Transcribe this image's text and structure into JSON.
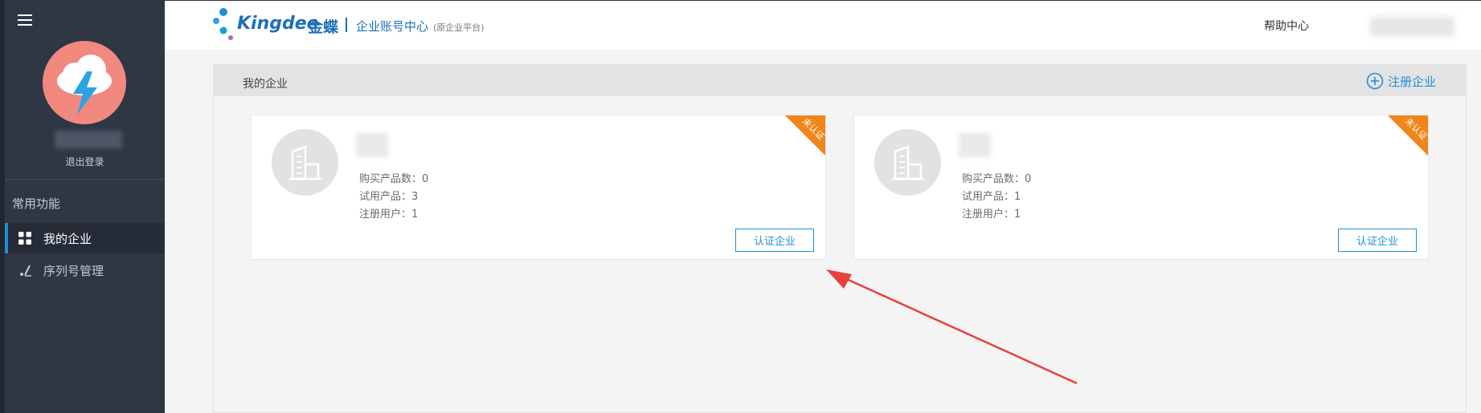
{
  "sidebar": {
    "logout_label": "退出登录",
    "section_title": "常用功能",
    "items": [
      {
        "label": "我的企业",
        "icon": "grid-icon",
        "active": true
      },
      {
        "label": "序列号管理",
        "icon": "brush-icon",
        "active": false
      }
    ]
  },
  "header": {
    "brand": "Kingdee",
    "brand_cn": "金蝶",
    "title": "企业账号中心",
    "subtitle": "(原企业平台)",
    "help_label": "帮助中心"
  },
  "panel": {
    "title": "我的企业",
    "register_label": "注册企业"
  },
  "companies": [
    {
      "ribbon": "未认证",
      "purchased_label": "购买产品数：0",
      "trial_label": "试用产品：3",
      "users_label": "注册用户：1",
      "verify_label": "认证企业"
    },
    {
      "ribbon": "未认证",
      "purchased_label": "购买产品数：0",
      "trial_label": "试用产品：1",
      "users_label": "注册用户：1",
      "verify_label": "认证企业"
    }
  ],
  "colors": {
    "accent": "#1e8fd8",
    "sidebar_bg": "#2f3644",
    "ribbon": "#f08519",
    "annotation_arrow": "#e8413c"
  }
}
